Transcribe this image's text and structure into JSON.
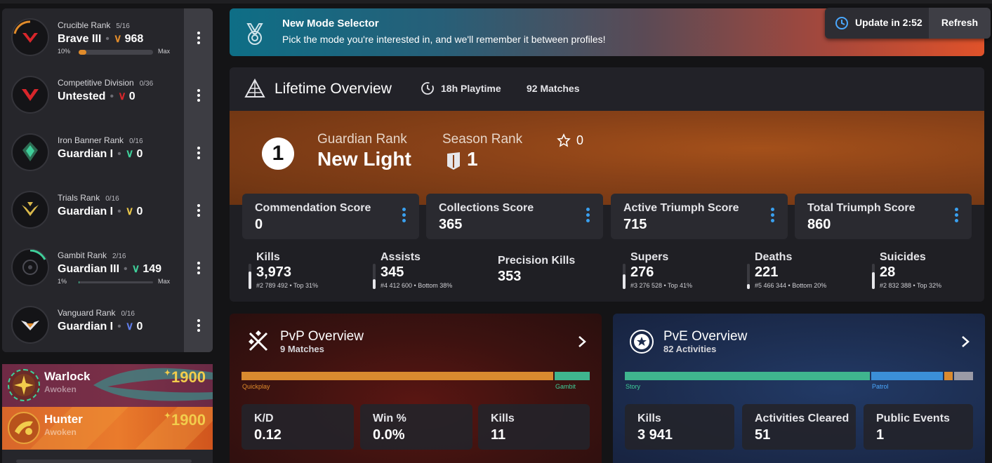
{
  "sidebar": {
    "ranks": [
      {
        "label": "Crucible Rank",
        "count": "5/16",
        "name": "Brave III",
        "points": "968",
        "progress_label": "10%",
        "max_label": "Max",
        "progress": 0.1,
        "accent": "#e08b2b"
      },
      {
        "label": "Competitive Division",
        "count": "0/36",
        "name": "Untested",
        "points": "0",
        "accent": "#d8262b"
      },
      {
        "label": "Iron Banner Rank",
        "count": "0/16",
        "name": "Guardian I",
        "points": "0",
        "accent": "#3fcf9a"
      },
      {
        "label": "Trials Rank",
        "count": "0/16",
        "name": "Guardian I",
        "points": "0",
        "accent": "#e8c64a"
      },
      {
        "label": "Gambit Rank",
        "count": "2/16",
        "name": "Guardian III",
        "points": "149",
        "progress_label": "1%",
        "max_label": "Max",
        "progress": 0.01,
        "accent": "#3fcf9a"
      },
      {
        "label": "Vanguard Rank",
        "count": "0/16",
        "name": "Guardian I",
        "points": "0",
        "accent": "#5f7ce8"
      }
    ],
    "characters": [
      {
        "class": "Warlock",
        "race": "Awoken",
        "power": "1900",
        "icon": "warlock-emblem-icon"
      },
      {
        "class": "Hunter",
        "race": "Awoken",
        "power": "1900",
        "icon": "hunter-emblem-icon"
      }
    ]
  },
  "banner": {
    "title": "New Mode Selector",
    "subtitle": "Pick the mode you're interested in, and we'll remember it between profiles!"
  },
  "update": {
    "label": "Update in 2:52",
    "refresh": "Refresh"
  },
  "lifetime": {
    "title": "Lifetime Overview",
    "playtime": "18h Playtime",
    "matches": "92 Matches",
    "rank_number": "1",
    "guardian_rank_label": "Guardian Rank",
    "guardian_rank_value": "New Light",
    "season_rank_label": "Season Rank",
    "season_rank_value": "1",
    "stars": "0",
    "scores": [
      {
        "label": "Commendation Score",
        "value": "0"
      },
      {
        "label": "Collections Score",
        "value": "365"
      },
      {
        "label": "Active Triumph Score",
        "value": "715"
      },
      {
        "label": "Total Triumph Score",
        "value": "860"
      }
    ],
    "stats": [
      {
        "label": "Kills",
        "value": "3,973",
        "sub": "#2 789 492 • Top 31%",
        "fill": 0.69
      },
      {
        "label": "Assists",
        "value": "345",
        "sub": "#4 412 600 • Bottom 38%",
        "fill": 0.38
      },
      {
        "label": "Precision Kills",
        "value": "353",
        "sub": "",
        "fill": null
      },
      {
        "label": "Supers",
        "value": "276",
        "sub": "#3 276 528 • Top 41%",
        "fill": 0.59
      },
      {
        "label": "Deaths",
        "value": "221",
        "sub": "#5 466 344 • Bottom 20%",
        "fill": 0.2
      },
      {
        "label": "Suicides",
        "value": "28",
        "sub": "#2 832 388 • Top 32%",
        "fill": 0.68
      }
    ]
  },
  "pvp": {
    "title": "PvP Overview",
    "subtitle": "9 Matches",
    "bar": [
      {
        "label": "Quickplay",
        "share": 0.9,
        "color": "#d98a2f"
      },
      {
        "label": "Gambit",
        "share": 0.1,
        "color": "#3fb58e"
      }
    ],
    "tiles": [
      {
        "label": "K/D",
        "value": "0.12"
      },
      {
        "label": "Win %",
        "value": "0.0%"
      },
      {
        "label": "Kills",
        "value": "11"
      }
    ]
  },
  "pve": {
    "title": "PvE Overview",
    "subtitle": "82 Activities",
    "bar": [
      {
        "label": "Story",
        "share": 0.705,
        "color": "#3fb58e"
      },
      {
        "label": "Patrol",
        "share": 0.21,
        "color": "#3b8fd8"
      },
      {
        "label": "",
        "share": 0.025,
        "color": "#d98a2f"
      },
      {
        "label": "",
        "share": 0.06,
        "color": "#9a9aa6"
      }
    ],
    "tiles": [
      {
        "label": "Kills",
        "value": "3 941"
      },
      {
        "label": "Activities Cleared",
        "value": "51"
      },
      {
        "label": "Public Events",
        "value": "1"
      }
    ]
  }
}
